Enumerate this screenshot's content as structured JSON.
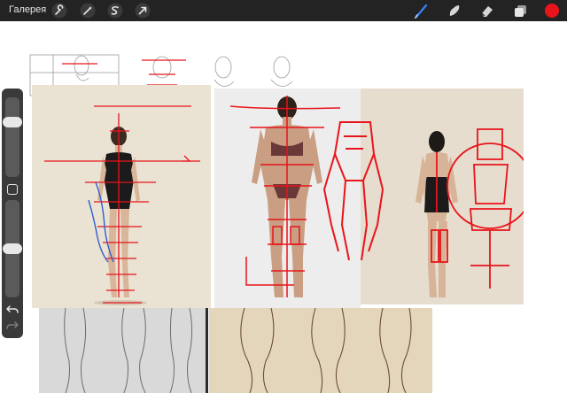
{
  "app": {
    "gallery_label": "Галерея"
  },
  "toolbar": {
    "left_tools": [
      "wrench-icon",
      "magic-wand-icon",
      "selection-icon",
      "transform-arrow-icon"
    ],
    "right_tools": [
      "brush-icon",
      "smudge-icon",
      "eraser-icon",
      "layers-icon"
    ],
    "active_color": "#e8141b",
    "brush_active_color": "#3b82f6"
  },
  "sidebar": {
    "brush_size_level": 0.72,
    "opacity_level": 0.5,
    "undo": "undo-icon",
    "redo": "redo-icon"
  },
  "colors": {
    "toolbar_bg": "#232323",
    "sidebar_bg": "#3a3a3a",
    "sketch_red": "#e8141b",
    "sketch_blue": "#2f5fd0",
    "photo_bg_warm": "#eae2d3",
    "photo_bg_cool": "#efefef"
  }
}
